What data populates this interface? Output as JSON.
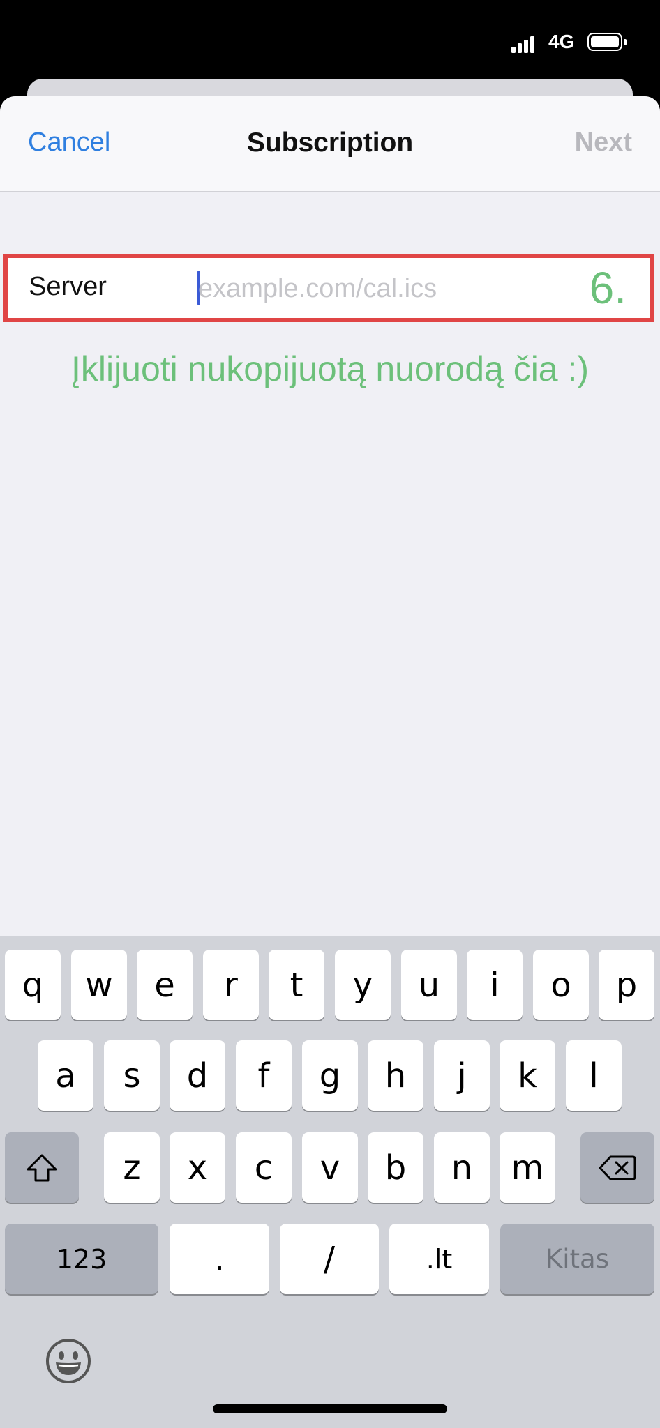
{
  "status": {
    "network": "4G"
  },
  "navbar": {
    "cancel_label": "Cancel",
    "title": "Subscription",
    "next_label": "Next"
  },
  "form": {
    "server_label": "Server",
    "server_placeholder": "example.com/cal.ics",
    "server_value": "",
    "step_number": "6."
  },
  "annotation": {
    "note": "Įklijuoti nukopijuotą nuorodą čia :)"
  },
  "keyboard": {
    "row1": [
      "q",
      "w",
      "e",
      "r",
      "t",
      "y",
      "u",
      "i",
      "o",
      "p"
    ],
    "row2": [
      "a",
      "s",
      "d",
      "f",
      "g",
      "h",
      "j",
      "k",
      "l"
    ],
    "row3": [
      "z",
      "x",
      "c",
      "v",
      "b",
      "n",
      "m"
    ],
    "numbers_label": "123",
    "dot_label": ".",
    "slash_label": "/",
    "lt_label": ".lt",
    "return_label": "Kitas"
  },
  "colors": {
    "accent": "#2f7fe0",
    "annotation_green": "#6cc07a",
    "highlight_red": "#e04545"
  }
}
